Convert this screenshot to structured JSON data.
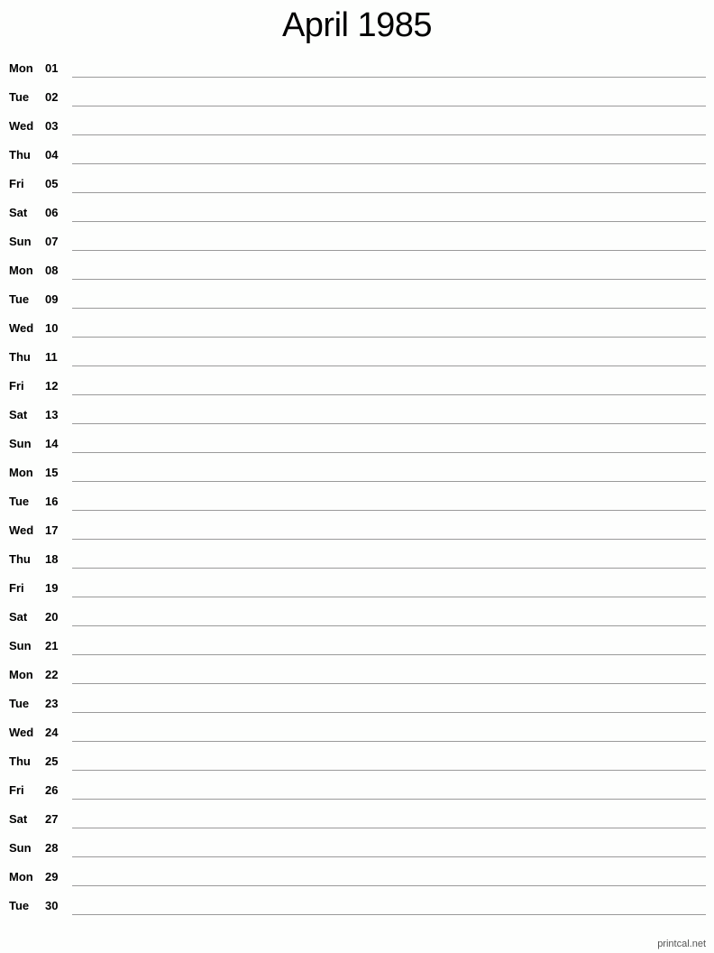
{
  "calendar": {
    "title": "April 1985",
    "days": [
      {
        "weekday": "Mon",
        "day": "01"
      },
      {
        "weekday": "Tue",
        "day": "02"
      },
      {
        "weekday": "Wed",
        "day": "03"
      },
      {
        "weekday": "Thu",
        "day": "04"
      },
      {
        "weekday": "Fri",
        "day": "05"
      },
      {
        "weekday": "Sat",
        "day": "06"
      },
      {
        "weekday": "Sun",
        "day": "07"
      },
      {
        "weekday": "Mon",
        "day": "08"
      },
      {
        "weekday": "Tue",
        "day": "09"
      },
      {
        "weekday": "Wed",
        "day": "10"
      },
      {
        "weekday": "Thu",
        "day": "11"
      },
      {
        "weekday": "Fri",
        "day": "12"
      },
      {
        "weekday": "Sat",
        "day": "13"
      },
      {
        "weekday": "Sun",
        "day": "14"
      },
      {
        "weekday": "Mon",
        "day": "15"
      },
      {
        "weekday": "Tue",
        "day": "16"
      },
      {
        "weekday": "Wed",
        "day": "17"
      },
      {
        "weekday": "Thu",
        "day": "18"
      },
      {
        "weekday": "Fri",
        "day": "19"
      },
      {
        "weekday": "Sat",
        "day": "20"
      },
      {
        "weekday": "Sun",
        "day": "21"
      },
      {
        "weekday": "Mon",
        "day": "22"
      },
      {
        "weekday": "Tue",
        "day": "23"
      },
      {
        "weekday": "Wed",
        "day": "24"
      },
      {
        "weekday": "Thu",
        "day": "25"
      },
      {
        "weekday": "Fri",
        "day": "26"
      },
      {
        "weekday": "Sat",
        "day": "27"
      },
      {
        "weekday": "Sun",
        "day": "28"
      },
      {
        "weekday": "Mon",
        "day": "29"
      },
      {
        "weekday": "Tue",
        "day": "30"
      }
    ]
  },
  "footer": {
    "credit": "printcal.net"
  },
  "colors": {
    "line": "#9a9a9a",
    "background": "#fdfefd"
  }
}
